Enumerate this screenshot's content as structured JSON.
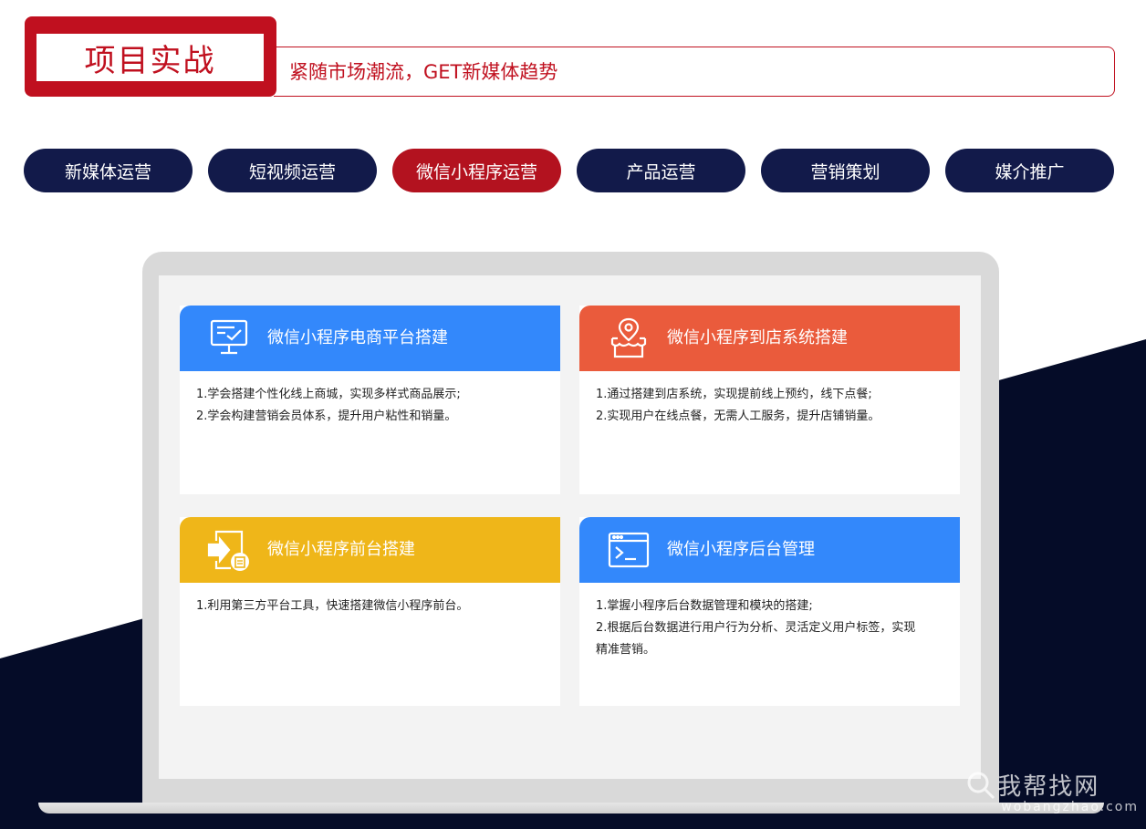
{
  "colors": {
    "brand_red": "#c0101f",
    "tab_navy": "#121a4a",
    "tab_active": "#b3121f",
    "dark_bg": "#050c28",
    "card_blue": "#3388fb",
    "card_orange": "#ea5b3c",
    "card_yellow": "#efb619"
  },
  "header": {
    "title": "项目实战",
    "slogan": "紧随市场潮流，GET新媒体趋势"
  },
  "tabs": [
    {
      "label": "新媒体运营",
      "active": false
    },
    {
      "label": "短视频运营",
      "active": false
    },
    {
      "label": "微信小程序运营",
      "active": true
    },
    {
      "label": "产品运营",
      "active": false
    },
    {
      "label": "营销策划",
      "active": false
    },
    {
      "label": "媒介推广",
      "active": false
    }
  ],
  "cards": [
    {
      "title": "微信小程序电商平台搭建",
      "icon": "monitor-check-icon",
      "color": "#3388fb",
      "lines": [
        "1.学会搭建个性化线上商城，实现多样式商品展示;",
        "2.学会构建营销会员体系，提升用户粘性和销量。"
      ]
    },
    {
      "title": "微信小程序到店系统搭建",
      "icon": "store-location-icon",
      "color": "#ea5b3c",
      "lines": [
        "1.通过搭建到店系统，实现提前线上预约，线下点餐;",
        "2.实现用户在线点餐，无需人工服务，提升店铺销量。"
      ]
    },
    {
      "title": "微信小程序前台搭建",
      "icon": "export-document-icon",
      "color": "#efb619",
      "lines": [
        "1.利用第三方平台工具，快速搭建微信小程序前台。"
      ]
    },
    {
      "title": "微信小程序后台管理",
      "icon": "terminal-window-icon",
      "color": "#3388fb",
      "lines": [
        "1.掌握小程序后台数据管理和模块的搭建;",
        "2.根据后台数据进行用户行为分析、灵活定义用户标签，实现",
        "精准营销。"
      ]
    }
  ],
  "watermark": {
    "name": "我帮找网",
    "url": "wobangzhao.com",
    "icon": "magnifier-icon"
  }
}
